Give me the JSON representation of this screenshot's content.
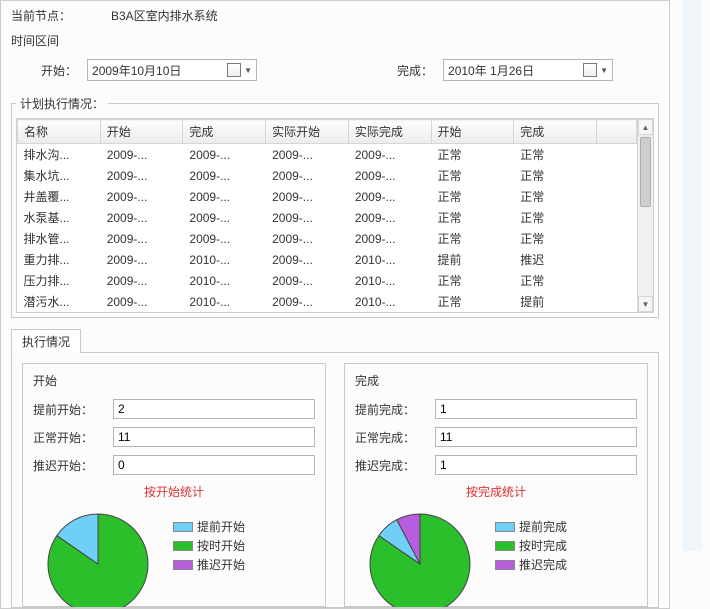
{
  "header": {
    "current_node_label": "当前节点：",
    "current_node_value": "B3A区室内排水系统"
  },
  "time_range": {
    "section_label": "时间区间",
    "start_label": "开始：",
    "start_value": "2009年10月10日",
    "end_label": "完成：",
    "end_value": "2010年 1月26日"
  },
  "plan": {
    "legend": "计划执行情况：",
    "columns": [
      "名称",
      "开始",
      "完成",
      "实际开始",
      "实际完成",
      "开始",
      "完成"
    ],
    "rows": [
      {
        "c": [
          "排水沟...",
          "2009-...",
          "2009-...",
          "2009-...",
          "2009-...",
          "正常",
          "正常"
        ]
      },
      {
        "c": [
          "集水坑...",
          "2009-...",
          "2009-...",
          "2009-...",
          "2009-...",
          "正常",
          "正常"
        ]
      },
      {
        "c": [
          "井盖覆...",
          "2009-...",
          "2009-...",
          "2009-...",
          "2009-...",
          "正常",
          "正常"
        ]
      },
      {
        "c": [
          "水泵基...",
          "2009-...",
          "2009-...",
          "2009-...",
          "2009-...",
          "正常",
          "正常"
        ]
      },
      {
        "c": [
          "排水管...",
          "2009-...",
          "2009-...",
          "2009-...",
          "2009-...",
          "正常",
          "正常"
        ]
      },
      {
        "c": [
          "重力排...",
          "2009-...",
          "2010-...",
          "2009-...",
          "2010-...",
          "提前",
          "推迟"
        ]
      },
      {
        "c": [
          "压力排...",
          "2009-...",
          "2010-...",
          "2009-...",
          "2010-...",
          "正常",
          "正常"
        ]
      },
      {
        "c": [
          "潜污水...",
          "2009-...",
          "2010-...",
          "2009-...",
          "2010-...",
          "正常",
          "提前"
        ]
      }
    ]
  },
  "exec_tab": {
    "tab_label": "执行情况",
    "start_panel": {
      "title": "开始",
      "early_label": "提前开始：",
      "early_value": "2",
      "normal_label": "正常开始：",
      "normal_value": "11",
      "late_label": "推迟开始：",
      "late_value": "0",
      "chart_title": "按开始统计",
      "legend": {
        "early": "提前开始",
        "ontime": "按时开始",
        "late": "推迟开始"
      }
    },
    "finish_panel": {
      "title": "完成",
      "early_label": "提前完成：",
      "early_value": "1",
      "normal_label": "正常完成：",
      "normal_value": "11",
      "late_label": "推迟完成：",
      "late_value": "1",
      "chart_title": "按完成统计",
      "legend": {
        "early": "提前完成",
        "ontime": "按时完成",
        "late": "推迟完成"
      }
    }
  },
  "colors": {
    "early": "#6fcff5",
    "ontime": "#2bbf2b",
    "late": "#b85de0"
  },
  "chart_data": [
    {
      "type": "pie",
      "title": "按开始统计",
      "series": [
        {
          "name": "开始",
          "values": [
            2,
            11,
            0
          ]
        }
      ],
      "categories": [
        "提前开始",
        "按时开始",
        "推迟开始"
      ],
      "colors": [
        "#6fcff5",
        "#2bbf2b",
        "#b85de0"
      ]
    },
    {
      "type": "pie",
      "title": "按完成统计",
      "series": [
        {
          "name": "完成",
          "values": [
            1,
            11,
            1
          ]
        }
      ],
      "categories": [
        "提前完成",
        "按时完成",
        "推迟完成"
      ],
      "colors": [
        "#6fcff5",
        "#2bbf2b",
        "#b85de0"
      ]
    }
  ]
}
